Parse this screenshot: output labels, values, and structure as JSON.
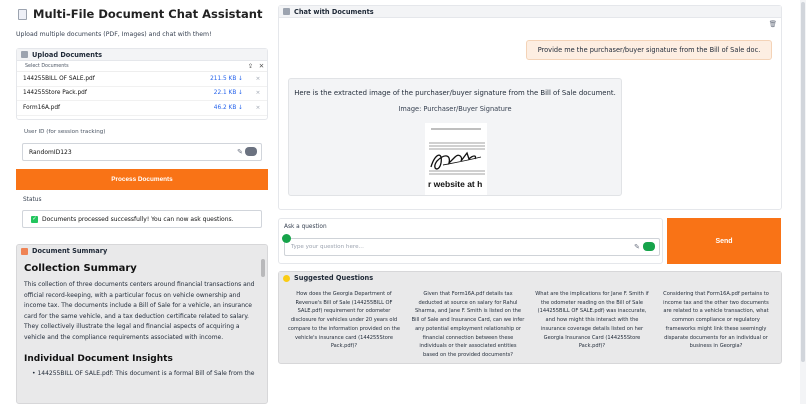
{
  "app": {
    "title": "Multi-File Document Chat Assistant",
    "subtitle": "Upload multiple documents (PDF, Images) and chat with them!"
  },
  "upload": {
    "header": "Upload Documents",
    "select_label": "Select Documents",
    "files": [
      {
        "name": "144255BILL OF SALE.pdf",
        "size": "211.5 KB ↓"
      },
      {
        "name": "144255Store Pack.pdf",
        "size": "22.1 KB ↓"
      },
      {
        "name": "Form16A.pdf",
        "size": "46.2 KB ↓"
      }
    ]
  },
  "user_id": {
    "label": "User ID (for session tracking)",
    "value": "RandomID123"
  },
  "process_button": "Process Documents",
  "status": {
    "label": "Status",
    "message": "Documents processed successfully! You can now ask questions."
  },
  "summary": {
    "header": "Document Summary",
    "heading": "Collection Summary",
    "paragraph": "This collection of three documents centers around financial transactions and official record-keeping, with a particular focus on vehicle ownership and income tax. The documents include a Bill of Sale for a vehicle, an insurance card for the same vehicle, and a tax deduction certificate related to salary. They collectively illustrate the legal and financial aspects of acquiring a vehicle and the compliance requirements associated with income.",
    "subheading": "Individual Document Insights",
    "item": "144255BILL OF SALE.pdf: This document is a formal Bill of Sale from the"
  },
  "chat": {
    "header": "Chat with Documents",
    "user_message": "Provide me the purchaser/buyer signature from the Bill of Sale doc.",
    "bot_message": "Here is the extracted image of the purchaser/buyer signature from the Bill of Sale document.",
    "image_caption": "Image: Purchaser/Buyer Signature",
    "image_text": "r website at h"
  },
  "question": {
    "label": "Ask a question",
    "placeholder": "Type your question here..."
  },
  "send_button": "Send",
  "suggestions": {
    "header": "Suggested Questions",
    "items": [
      "How does the Georgia Department of Revenue's Bill of Sale (144255BILL OF SALE.pdf) requirement for odometer disclosure for vehicles under 20 years old compare to the information provided on the vehicle's insurance card (144255Store Pack.pdf)?",
      "Given that Form16A.pdf details tax deducted at source on salary for Rahul Sharma, and Jane F. Smith is listed on the Bill of Sale and Insurance Card, can we infer any potential employment relationship or financial connection between these individuals or their associated entities based on the provided documents?",
      "What are the implications for Jane F. Smith if the odometer reading on the Bill of Sale (144255BILL OF SALE.pdf) was inaccurate, and how might this interact with the insurance coverage details listed on her Georgia Insurance Card (144255Store Pack.pdf)?",
      "Considering that Form16A.pdf pertains to income tax and the other two documents are related to a vehicle transaction, what common compliance or regulatory frameworks might link these seemingly disparate documents for an individual or business in Georgia?"
    ]
  },
  "colors": {
    "accent": "#f97316",
    "link": "#2563eb",
    "success": "#22c55e",
    "user_bubble": "#fdeee2"
  },
  "icons": [
    "document-icon",
    "upload-icon",
    "close-icon",
    "pencil-icon",
    "grammar-icon",
    "check-icon",
    "summary-icon",
    "chat-icon",
    "trash-icon",
    "lightbulb-icon"
  ]
}
